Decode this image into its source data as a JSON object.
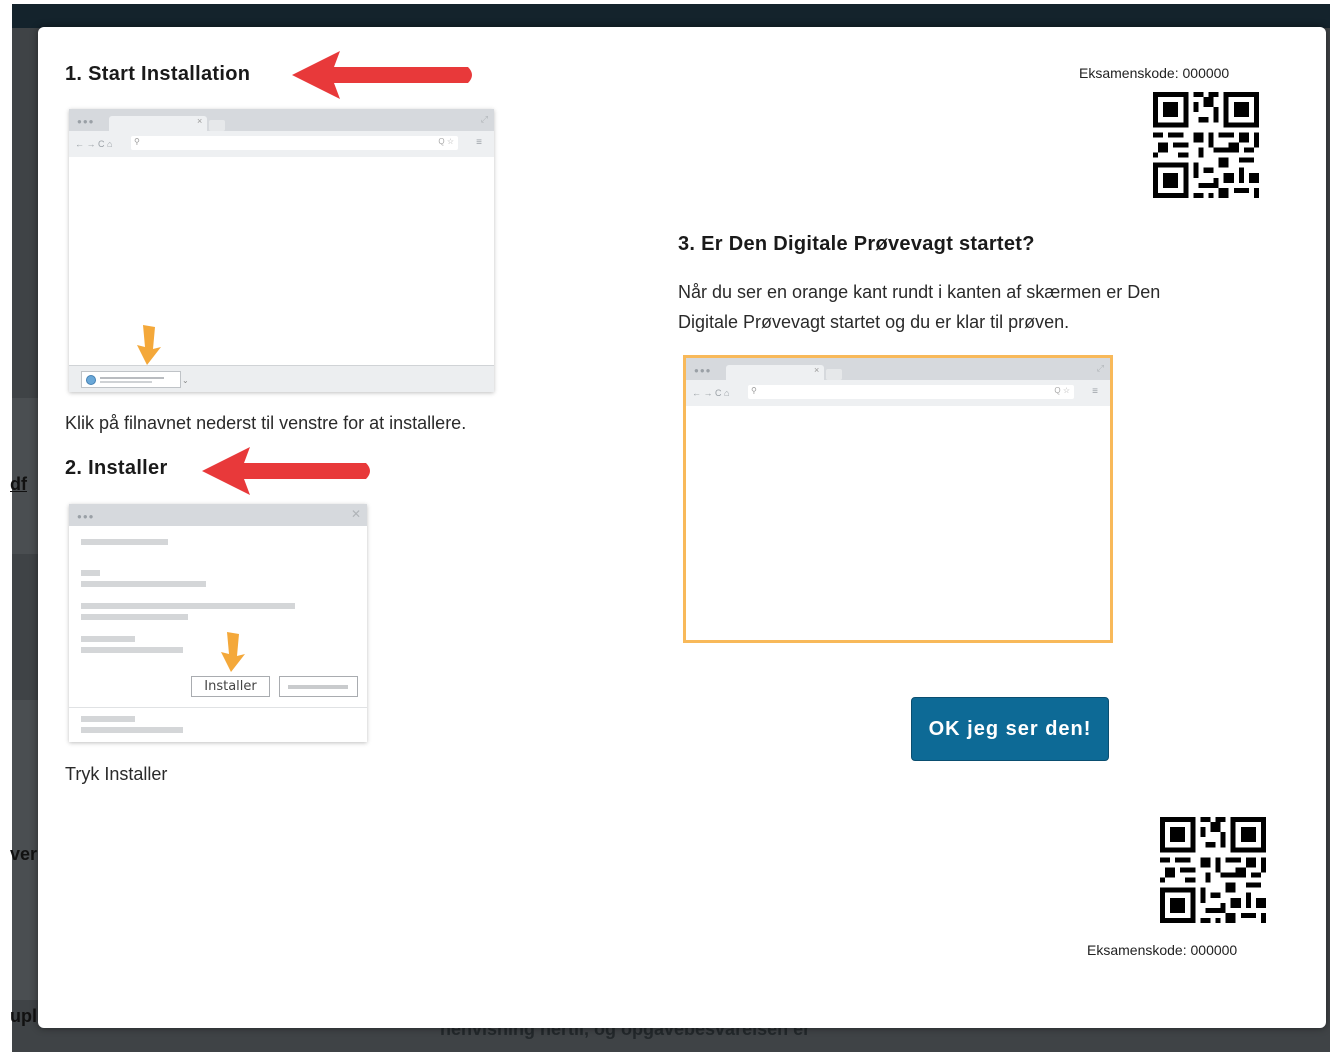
{
  "background": {
    "side_labels": [
      "df",
      "ver",
      "upl"
    ],
    "ghost_line_1": "henvisning hertil, og opgavebesvarelsen er",
    "ghost_line_2": "... ... ..."
  },
  "step1": {
    "heading": "1. Start Installation",
    "caption": "Klik på filnavnet nederst til venstre for at installere."
  },
  "step2": {
    "heading": "2. Installer",
    "dialog_button": "Installer",
    "caption": "Tryk Installer"
  },
  "step3": {
    "heading": "3. Er Den Digitale Prøvevagt startet?",
    "text_line_1": "Når du ser en orange kant rundt i kanten af skærmen er Den",
    "text_line_2": "Digitale Prøvevagt startet og du er klar til prøven."
  },
  "exam_code_top": "Eksamenskode: 000000",
  "exam_code_bottom": "Eksamenskode: 000000",
  "ok_button": "OK jeg ser den!",
  "colors": {
    "accent_button": "#0d6a96",
    "arrow_red": "#e8393a",
    "arrow_orange": "#f4a83a",
    "orange_border": "#f8b95a"
  },
  "icons": {
    "arrow": "red-left-arrow",
    "hint": "orange-down-arrow",
    "qr": "qr-code"
  }
}
